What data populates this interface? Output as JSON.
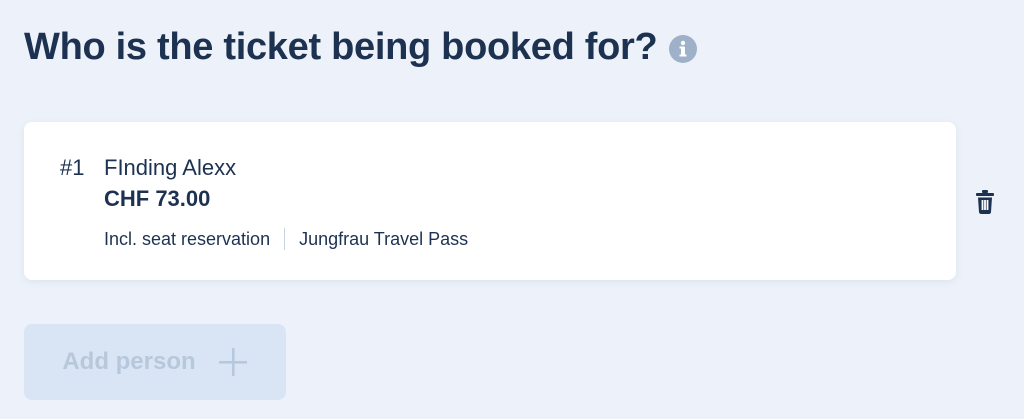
{
  "header": {
    "title": "Who is the ticket being booked for?",
    "info_icon": "info-circle-icon"
  },
  "passengers": [
    {
      "number": "#1",
      "name": "FInding Alexx",
      "price": "CHF 73.00",
      "options": [
        "Incl. seat reservation",
        "Jungfrau Travel Pass"
      ]
    }
  ],
  "actions": {
    "delete_icon": "trash-icon",
    "add_person_label": "Add person",
    "add_person_icon": "plus-icon",
    "add_person_enabled": false
  },
  "colors": {
    "background": "#edf2fa",
    "text": "#1d3250",
    "info_icon": "#9fb0c9",
    "button_disabled_bg": "#d9e5f4",
    "button_disabled_text": "#b8c8dc"
  }
}
